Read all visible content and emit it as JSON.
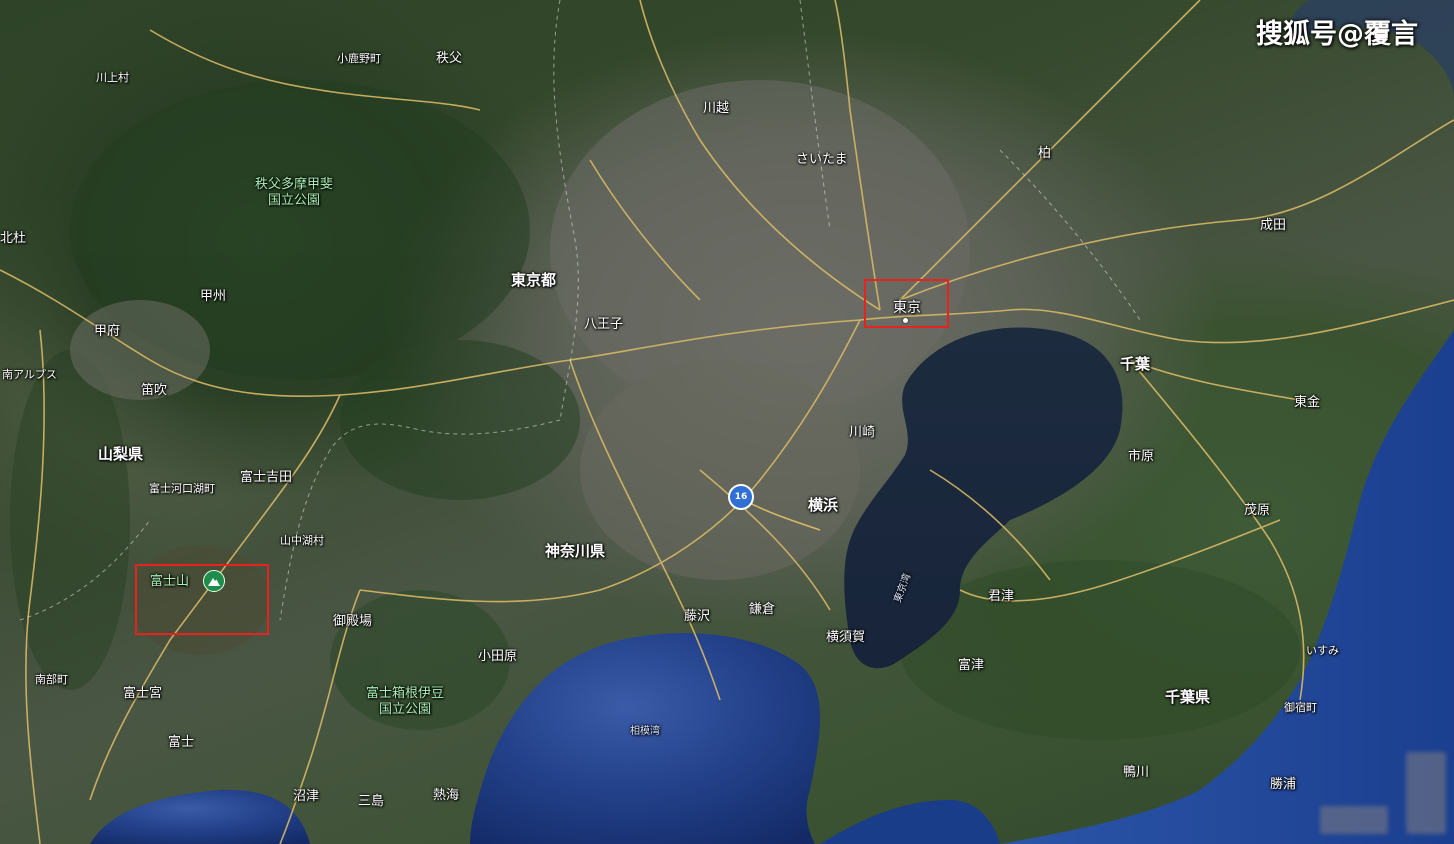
{
  "watermark": "搜狐号@覆言",
  "colors": {
    "road": "#d7b865",
    "sea": "#16264a",
    "bay": "#1b2a40",
    "highlight": "#e8231e",
    "park_label": "#a9f0b4"
  },
  "route": {
    "number": "16"
  },
  "labels": {
    "kohanoyama": "小鹿野町",
    "chichibu": "秩父",
    "kawakami": "川上村",
    "kawagoe": "川越",
    "saitama": "さいたま",
    "kashiwa": "柏",
    "narita": "成田",
    "hokuto": "北杜",
    "kofu": "甲府",
    "koshu": "甲州",
    "minami_alps": "南アルプス",
    "fuefuki": "笛吹",
    "tokyo_to": "東京都",
    "hachioji": "八王子",
    "tokyo": "東京",
    "chiba": "千葉",
    "togane": "東金",
    "yamanashi_ken": "山梨県",
    "fujiyoshida": "富士吉田",
    "fujikawaguchiko": "富士河口湖町",
    "kawasaki": "川崎",
    "ichihara": "市原",
    "yokohama": "横浜",
    "yamanakako": "山中湖村",
    "mobara": "茂原",
    "kanagawa_ken": "神奈川県",
    "fujisan": "富士山",
    "kisarazu": "君津",
    "gotemba": "御殿場",
    "fujisawa": "藤沢",
    "kamakura": "鎌倉",
    "yokosuka": "横須賀",
    "isumi": "いすみ",
    "odawara": "小田原",
    "futtsu": "富津",
    "minobu": "南部町",
    "chiba_ken": "千葉県",
    "fujinomiya": "富士宮",
    "onjuku": "御宿町",
    "fuji": "富士",
    "kamogawa": "鴨川",
    "katsuura": "勝浦",
    "numazu": "沼津",
    "mishima": "三島",
    "atami": "熱海",
    "sagami_bay": "相模湾",
    "tokyo_bay": "東京湾"
  },
  "parks": {
    "chichibu_tama_line1": "秩父多摩甲斐",
    "chichibu_tama_line2": "国立公園",
    "fuji_hakone_line1": "富士箱根伊豆",
    "fuji_hakone_line2": "国立公園"
  },
  "highlights": [
    "東京",
    "富士山"
  ]
}
